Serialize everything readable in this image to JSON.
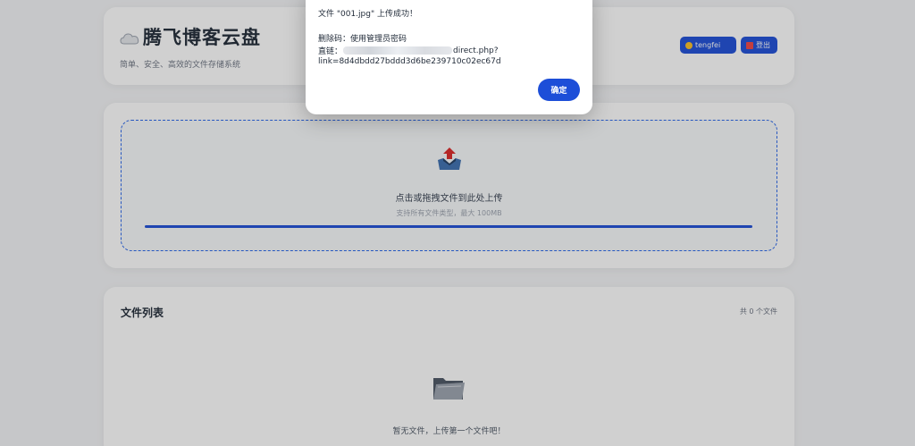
{
  "header": {
    "title": "腾飞博客云盘",
    "subtitle": "简单、安全、高效的文件存储系统",
    "user_label": "tengfei",
    "logout_label": "登出"
  },
  "upload": {
    "main_text": "点击或拖拽文件到此处上传",
    "hint_text": "支持所有文件类型，最大 100MB",
    "progress_percent": 100
  },
  "files": {
    "title": "文件列表",
    "count_label": "共 0 个文件",
    "empty_text": "暂无文件，上传第一个文件吧！"
  },
  "dialog": {
    "success_line": "文件 \"001.jpg\" 上传成功！",
    "delete_code_line": "删除码：使用管理员密码",
    "direct_link_label": "直链：",
    "direct_link_suffix": "direct.php?",
    "direct_link_query": "link=8d4dbdd27bddd3d6be239710c02ec67d",
    "confirm_label": "确定"
  },
  "colors": {
    "accent": "#1d4ed8",
    "background": "#f3f4f6"
  },
  "icons": {
    "brand": "cloud-icon",
    "user": "user-icon",
    "logout": "logout-icon",
    "upload": "upload-inbox-icon",
    "empty": "folder-icon"
  }
}
